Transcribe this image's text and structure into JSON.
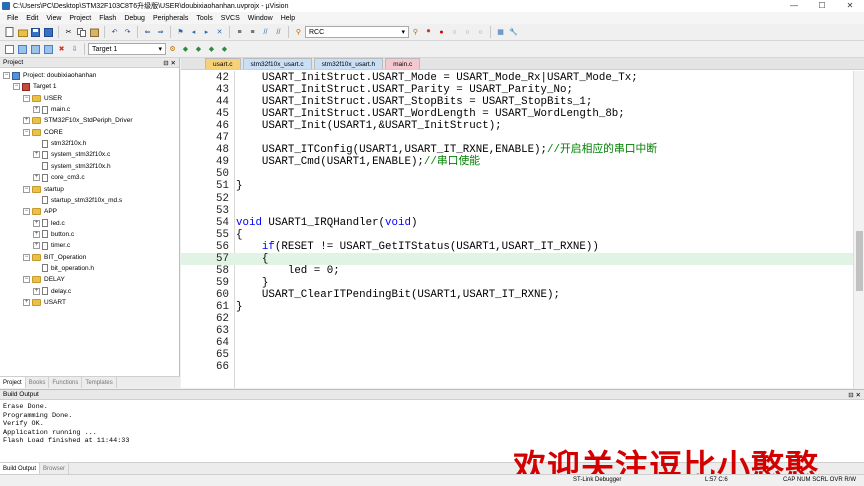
{
  "window": {
    "title": "C:\\Users\\PC\\Desktop\\STM32F103C8T6升级版\\USER\\doubixiaohanhan.uvprojx - µVision",
    "controls": [
      "—",
      "☐",
      "✕"
    ]
  },
  "menu": [
    "File",
    "Edit",
    "View",
    "Project",
    "Flash",
    "Debug",
    "Peripherals",
    "Tools",
    "SVCS",
    "Window",
    "Help"
  ],
  "toolbar": {
    "search_value": "RCC",
    "target_value": "Target 1"
  },
  "project_panel": {
    "title": "Project",
    "tree": [
      {
        "label": "Project: doubixiaohanhan",
        "type": "project",
        "level": 0,
        "expander": "−"
      },
      {
        "label": "Target 1",
        "type": "target",
        "level": 1,
        "expander": "−"
      },
      {
        "label": "USER",
        "type": "folder",
        "level": 2,
        "expander": "−"
      },
      {
        "label": "main.c",
        "type": "file",
        "level": 3,
        "expander": "+"
      },
      {
        "label": "STM32F10x_StdPeriph_Driver",
        "type": "folder",
        "level": 2,
        "expander": "+"
      },
      {
        "label": "CORE",
        "type": "folder",
        "level": 2,
        "expander": "−"
      },
      {
        "label": "stm32f10x.h",
        "type": "file",
        "level": 3,
        "expander": ""
      },
      {
        "label": "system_stm32f10x.c",
        "type": "file",
        "level": 3,
        "expander": "+"
      },
      {
        "label": "system_stm32f10x.h",
        "type": "file",
        "level": 3,
        "expander": ""
      },
      {
        "label": "core_cm3.c",
        "type": "file",
        "level": 3,
        "expander": "+"
      },
      {
        "label": "startup",
        "type": "folder",
        "level": 2,
        "expander": "−"
      },
      {
        "label": "startup_stm32f10x_md.s",
        "type": "file",
        "level": 3,
        "expander": ""
      },
      {
        "label": "APP",
        "type": "folder",
        "level": 2,
        "expander": "−"
      },
      {
        "label": "led.c",
        "type": "file",
        "level": 3,
        "expander": "+"
      },
      {
        "label": "button.c",
        "type": "file",
        "level": 3,
        "expander": "+"
      },
      {
        "label": "timer.c",
        "type": "file",
        "level": 3,
        "expander": "+"
      },
      {
        "label": "BIT_Operation",
        "type": "folder",
        "level": 2,
        "expander": "−"
      },
      {
        "label": "bit_operation.h",
        "type": "file",
        "level": 3,
        "expander": ""
      },
      {
        "label": "DELAY",
        "type": "folder",
        "level": 2,
        "expander": "−"
      },
      {
        "label": "delay.c",
        "type": "file",
        "level": 3,
        "expander": "+"
      },
      {
        "label": "USART",
        "type": "folder",
        "level": 2,
        "expander": "+"
      }
    ],
    "tabs": [
      "Project",
      "Books",
      "Functions",
      "Templates"
    ]
  },
  "editor": {
    "tabs": [
      {
        "label": "usart.c",
        "color": "#f5d27a"
      },
      {
        "label": "stm32f10x_usart.c",
        "color": "#c9dff5"
      },
      {
        "label": "stm32f10x_usart.h",
        "color": "#c9dff5"
      },
      {
        "label": "main.c",
        "color": "#f5c8d0"
      }
    ],
    "lines": [
      {
        "n": "42",
        "t": "    USART_InitStruct.USART_Mode = USART_Mode_Rx|USART_Mode_Tx;"
      },
      {
        "n": "43",
        "t": "    USART_InitStruct.USART_Parity = USART_Parity_No;"
      },
      {
        "n": "44",
        "t": "    USART_InitStruct.USART_StopBits = USART_StopBits_1;"
      },
      {
        "n": "45",
        "t": "    USART_InitStruct.USART_WordLength = USART_WordLength_8b;"
      },
      {
        "n": "46",
        "t": "    USART_Init(USART1,&USART_InitStruct);"
      },
      {
        "n": "47",
        "t": ""
      },
      {
        "n": "48",
        "t": "    USART_ITConfig(USART1,USART_IT_RXNE,ENABLE);//开启相应的串口中断"
      },
      {
        "n": "49",
        "t": "    USART_Cmd(USART1,ENABLE);//串口使能"
      },
      {
        "n": "50",
        "t": ""
      },
      {
        "n": "51",
        "t": "}"
      },
      {
        "n": "52",
        "t": ""
      },
      {
        "n": "53",
        "t": ""
      },
      {
        "n": "54",
        "t": "void USART1_IRQHandler(void)"
      },
      {
        "n": "55",
        "t": "{"
      },
      {
        "n": "56",
        "t": "    if(RESET != USART_GetITStatus(USART1,USART_IT_RXNE))"
      },
      {
        "n": "57",
        "t": "    {"
      },
      {
        "n": "58",
        "t": "        led = 0;"
      },
      {
        "n": "59",
        "t": "    }"
      },
      {
        "n": "60",
        "t": "    USART_ClearITPendingBit(USART1,USART_IT_RXNE);"
      },
      {
        "n": "61",
        "t": "}"
      },
      {
        "n": "62",
        "t": ""
      },
      {
        "n": "63",
        "t": ""
      },
      {
        "n": "64",
        "t": ""
      },
      {
        "n": "65",
        "t": ""
      },
      {
        "n": "66",
        "t": ""
      }
    ],
    "highlight_line": "57"
  },
  "build_output": {
    "title": "Build Output",
    "lines": [
      "Erase Done.",
      "Programming Done.",
      "Verify OK.",
      "Application running ...",
      "Flash Load finished at 11:44:33"
    ],
    "tabs": [
      "Build Output",
      "Browser"
    ]
  },
  "overlay": {
    "watermark": "欢迎关注逗比小憨憨"
  },
  "status": {
    "debugger": "ST-Link Debugger",
    "position": "L:57 C:6",
    "indicators": "CAP  NUM  SCRL  OVR  R/W"
  }
}
